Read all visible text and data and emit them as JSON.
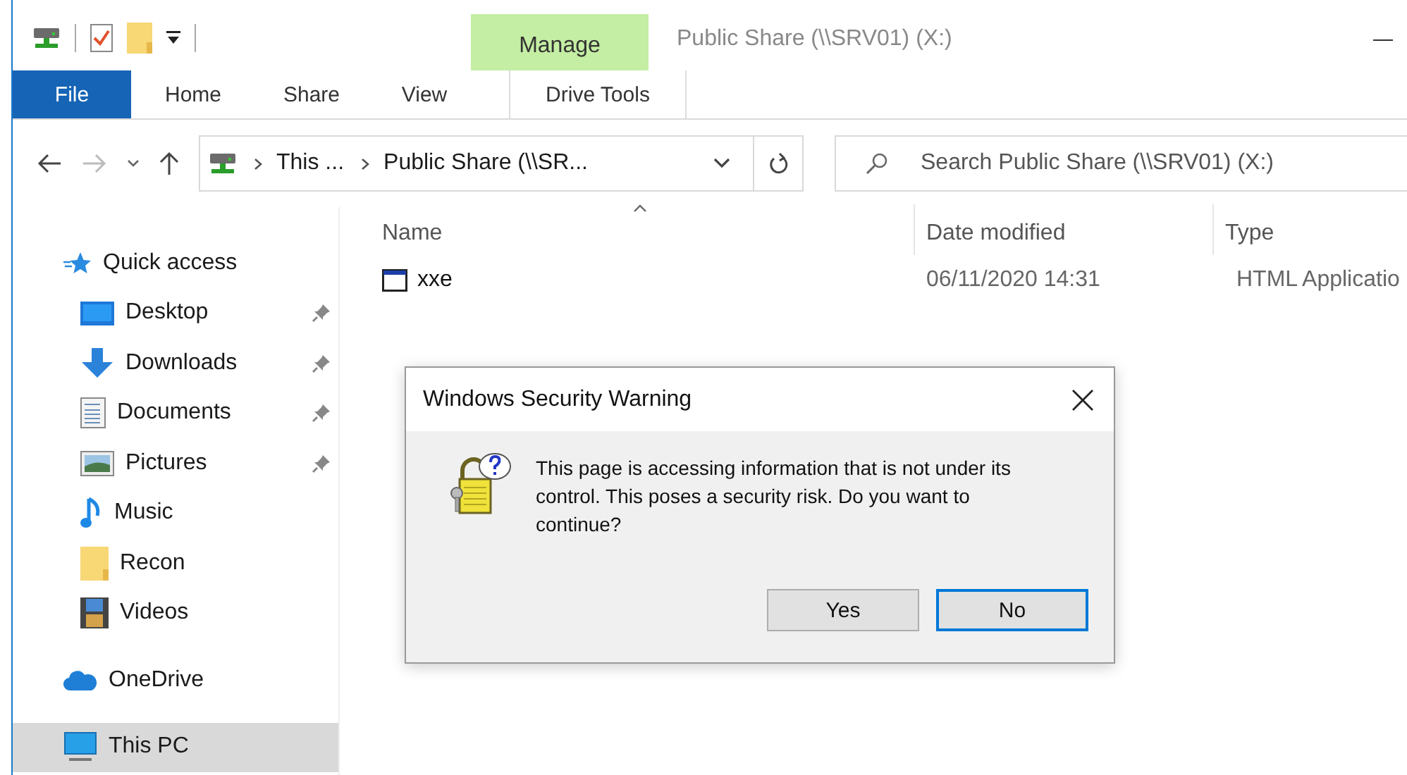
{
  "window": {
    "title": "Public Share (\\\\SRV01) (X:)"
  },
  "ribbon": {
    "context_label": "Manage",
    "tabs": [
      {
        "label": "File",
        "kind": "file"
      },
      {
        "label": "Home",
        "kind": "tab"
      },
      {
        "label": "Share",
        "kind": "tab"
      },
      {
        "label": "View",
        "kind": "tab"
      },
      {
        "label": "Drive Tools",
        "kind": "contextual"
      }
    ]
  },
  "address_bar": {
    "crumbs": [
      "This ...",
      "Public Share (\\\\SR..."
    ]
  },
  "search": {
    "placeholder": "Search Public Share (\\\\SRV01) (X:)"
  },
  "sidebar": {
    "items": [
      {
        "label": "Quick access",
        "kind": "section",
        "pinned": false,
        "selected": false
      },
      {
        "label": "Desktop",
        "kind": "item",
        "pinned": true,
        "selected": false
      },
      {
        "label": "Downloads",
        "kind": "item",
        "pinned": true,
        "selected": false
      },
      {
        "label": "Documents",
        "kind": "item",
        "pinned": true,
        "selected": false
      },
      {
        "label": "Pictures",
        "kind": "item",
        "pinned": true,
        "selected": false
      },
      {
        "label": "Music",
        "kind": "item",
        "pinned": false,
        "selected": false
      },
      {
        "label": "Recon",
        "kind": "item",
        "pinned": false,
        "selected": false
      },
      {
        "label": "Videos",
        "kind": "item",
        "pinned": false,
        "selected": false
      },
      {
        "label": "OneDrive",
        "kind": "section",
        "pinned": false,
        "selected": false
      },
      {
        "label": "This PC",
        "kind": "section",
        "pinned": false,
        "selected": true
      }
    ]
  },
  "table": {
    "columns": [
      {
        "label": "Name",
        "sorted": true
      },
      {
        "label": "Date modified",
        "sorted": false
      },
      {
        "label": "Type",
        "sorted": false
      }
    ],
    "rows": [
      {
        "cells": [
          "xxe",
          "06/11/2020 14:31",
          "HTML Applicatio"
        ]
      }
    ]
  },
  "dialog": {
    "title": "Windows Security Warning",
    "message": "This page is accessing information that is not under its control. This poses a security risk. Do you want to continue?",
    "buttons": [
      {
        "label": "Yes",
        "default": false
      },
      {
        "label": "No",
        "default": true
      }
    ]
  }
}
